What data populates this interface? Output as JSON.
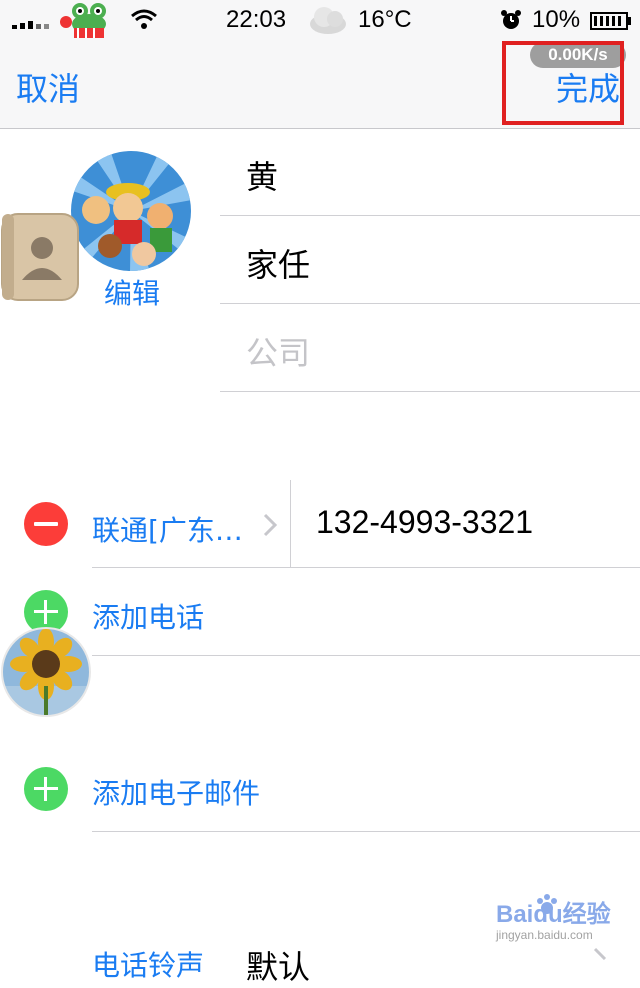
{
  "status_bar": {
    "time": "22:03",
    "temperature": "16°C",
    "battery": "10%",
    "icons": [
      "signal-icon",
      "frog-sticker-icon",
      "wifi-icon",
      "cloud-weather-icon",
      "alarm-icon",
      "battery-icon"
    ]
  },
  "nav": {
    "cancel": "取消",
    "done": "完成",
    "speed": "0.00K/s"
  },
  "contact": {
    "avatar_edit": "编辑",
    "last_name": "黄",
    "first_name": "家任",
    "company_placeholder": "公司"
  },
  "phone": {
    "label": "联通[广东…",
    "number": "132-4993-3321",
    "add_phone": "添加电话"
  },
  "email": {
    "add_email": "添加电子邮件"
  },
  "ringtone": {
    "label": "电话铃声",
    "value": "默认"
  },
  "watermark": {
    "brand": "Baidu经验",
    "url": "jingyan.baidu.com"
  },
  "colors": {
    "accent": "#1a7cf2",
    "delete": "#fc3d39",
    "add": "#4cd964",
    "highlight": "#e02020"
  }
}
